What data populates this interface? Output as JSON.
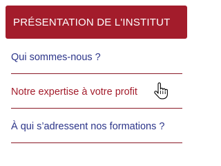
{
  "header": {
    "title": "PRÉSENTATION DE L'INSTITUT"
  },
  "menu": {
    "items": [
      {
        "label": "Qui sommes-nous ?"
      },
      {
        "label": "Notre expertise à votre profit"
      },
      {
        "label": "À qui s’adressent nos formations ?"
      }
    ]
  },
  "cursor": {
    "icon": "hand-pointer-icon"
  },
  "colors": {
    "header_bg": "#a31c2b",
    "link": "#2b3489",
    "link_hover": "#a31c2b",
    "divider": "#8a1a27"
  }
}
